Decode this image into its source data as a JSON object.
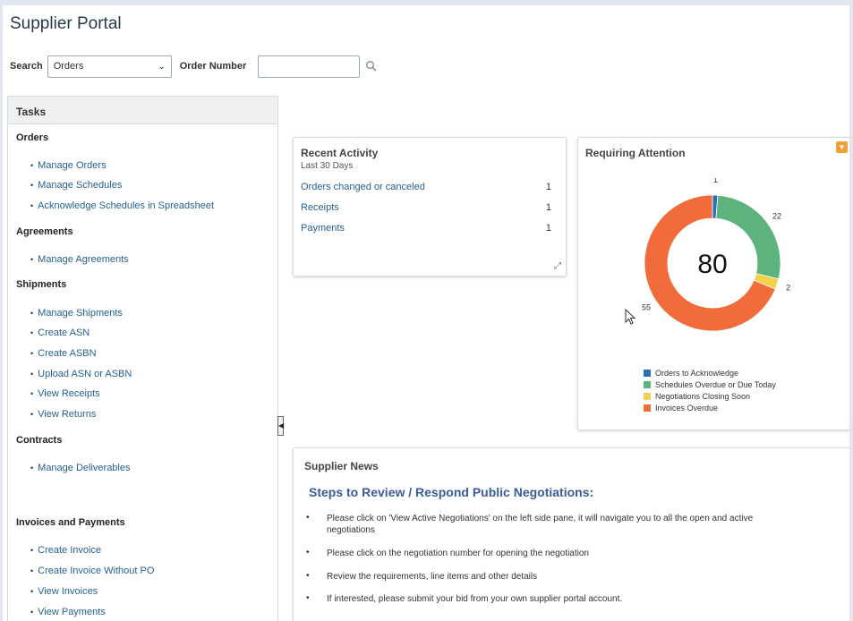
{
  "app": {
    "title": "Supplier Portal"
  },
  "search": {
    "label": "Search",
    "selected": "Orders",
    "order_number_label": "Order Number",
    "order_number_value": ""
  },
  "tasks": {
    "header": "Tasks",
    "sections": [
      {
        "title": "Orders",
        "items": [
          "Manage Orders",
          "Manage Schedules",
          "Acknowledge Schedules in Spreadsheet"
        ]
      },
      {
        "title": "Agreements",
        "items": [
          "Manage Agreements"
        ]
      },
      {
        "title": "Shipments",
        "items": [
          "Manage Shipments",
          "Create ASN",
          "Create ASBN",
          "Upload ASN or ASBN",
          "View Receipts",
          "View Returns"
        ]
      },
      {
        "title": "Contracts",
        "items": [
          "Manage Deliverables"
        ]
      },
      {
        "title": "Invoices and Payments",
        "items": [
          "Create Invoice",
          "Create Invoice Without PO",
          "View Invoices",
          "View Payments"
        ]
      }
    ]
  },
  "recent_activity": {
    "title": "Recent Activity",
    "subtitle": "Last 30 Days",
    "rows": [
      {
        "label": "Orders changed or canceled",
        "count": "1"
      },
      {
        "label": "Receipts",
        "count": "1"
      },
      {
        "label": "Payments",
        "count": "1"
      }
    ]
  },
  "requiring_attention": {
    "title": "Requiring Attention",
    "total": "80",
    "colors": {
      "acknowledge": "#2d6fb2",
      "schedules": "#5cb37d",
      "negotiations": "#f2d24b",
      "invoices": "#f26b3a"
    }
  },
  "chart_data": {
    "type": "pie",
    "title": "",
    "center_label": "80",
    "categories": [
      "Orders to Acknowledge",
      "Schedules Overdue or Due Today",
      "Negotiations Closing Soon",
      "Invoices Overdue"
    ],
    "values": [
      1,
      22,
      2,
      55
    ],
    "data_labels": [
      "1",
      "22",
      "2",
      "55"
    ],
    "colors": [
      "#2d6fb2",
      "#5cb37d",
      "#f2d24b",
      "#f26b3a"
    ],
    "legend_position": "bottom"
  },
  "supplier_news": {
    "title": "Supplier News",
    "headline": "Steps to Review / Respond Public Negotiations:",
    "items": [
      "Please click on 'View Active Negotiations' on the left side pane, it will navigate you to all the open and active negotiations",
      "Please click on the negotiation number for opening the negotiation",
      "Review the requirements, line items and other details",
      "If interested, please submit your bid from your own supplier portal account."
    ]
  }
}
